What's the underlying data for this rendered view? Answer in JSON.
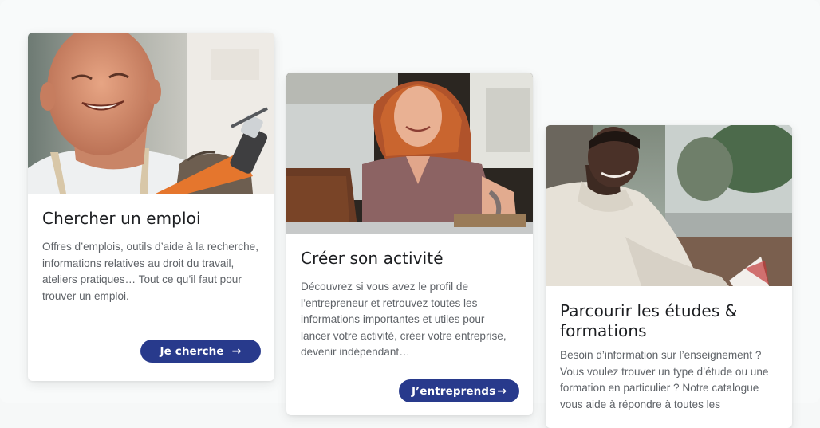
{
  "cards": [
    {
      "title": "Chercher un emploi",
      "description": "Offres d’emplois, outils d’aide à la recherche, informations relatives au droit du travail, ateliers pratiques… Tout ce qu’il faut pour trouver un emploi.",
      "button_label": "Je cherche",
      "button_icon": "arrow-right-icon",
      "photo": "smiling-man-with-grinder-photo"
    },
    {
      "title": "Créer son activité",
      "description": "Découvrez si vous avez le profil de l’entrepreneur et retrouvez toutes les informations importantes et utiles pour lancer votre activité, créer votre entreprise, devenir indépendant…",
      "button_label": "J’entreprends",
      "button_icon": "arrow-right-icon",
      "photo": "woman-with-laptop-photo"
    },
    {
      "title": "Parcourir les études & formations",
      "description": "Besoin d’information sur l’enseignement ? Vous voulez trouver un type d’étude ou une formation en particulier ? Notre catalogue vous aide à répondre à toutes les",
      "photo": "student-reading-outdoors-photo"
    }
  ],
  "colors": {
    "button_bg": "#283a8c",
    "button_text": "#ffffff",
    "title_text": "#1c1e21",
    "body_text": "#5f6368",
    "page_bg": "#f8fafa"
  }
}
